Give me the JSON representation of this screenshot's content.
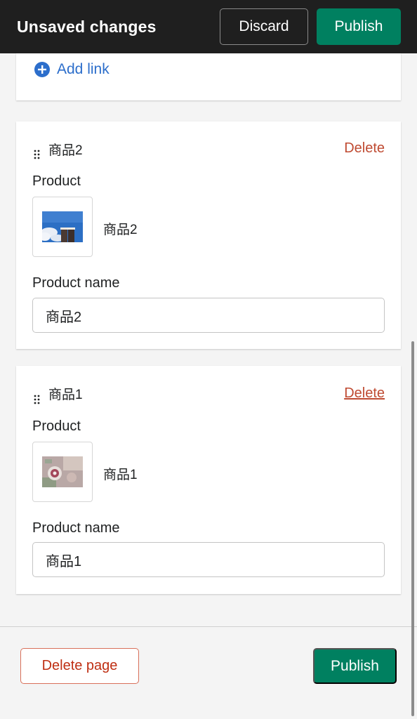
{
  "topbar": {
    "title": "Unsaved changes",
    "discard_label": "Discard",
    "publish_label": "Publish"
  },
  "links_card": {
    "add_link_label": "Add link",
    "add_link_icon": "plus-circle-icon"
  },
  "blocks": [
    {
      "title": "商品2",
      "delete_label": "Delete",
      "product_label": "Product",
      "product_name": "商品2",
      "product_name_label": "Product name",
      "product_name_value": "商品2"
    },
    {
      "title": "商品1",
      "delete_label": "Delete",
      "product_label": "Product",
      "product_name": "商品1",
      "product_name_label": "Product name",
      "product_name_value": "商品1"
    }
  ],
  "footer": {
    "delete_page_label": "Delete page",
    "publish_label": "Publish"
  },
  "colors": {
    "topbar_bg": "#1f1f1f",
    "primary": "#008060",
    "link": "#2c6ecb",
    "destructive": "#bf4a31"
  }
}
